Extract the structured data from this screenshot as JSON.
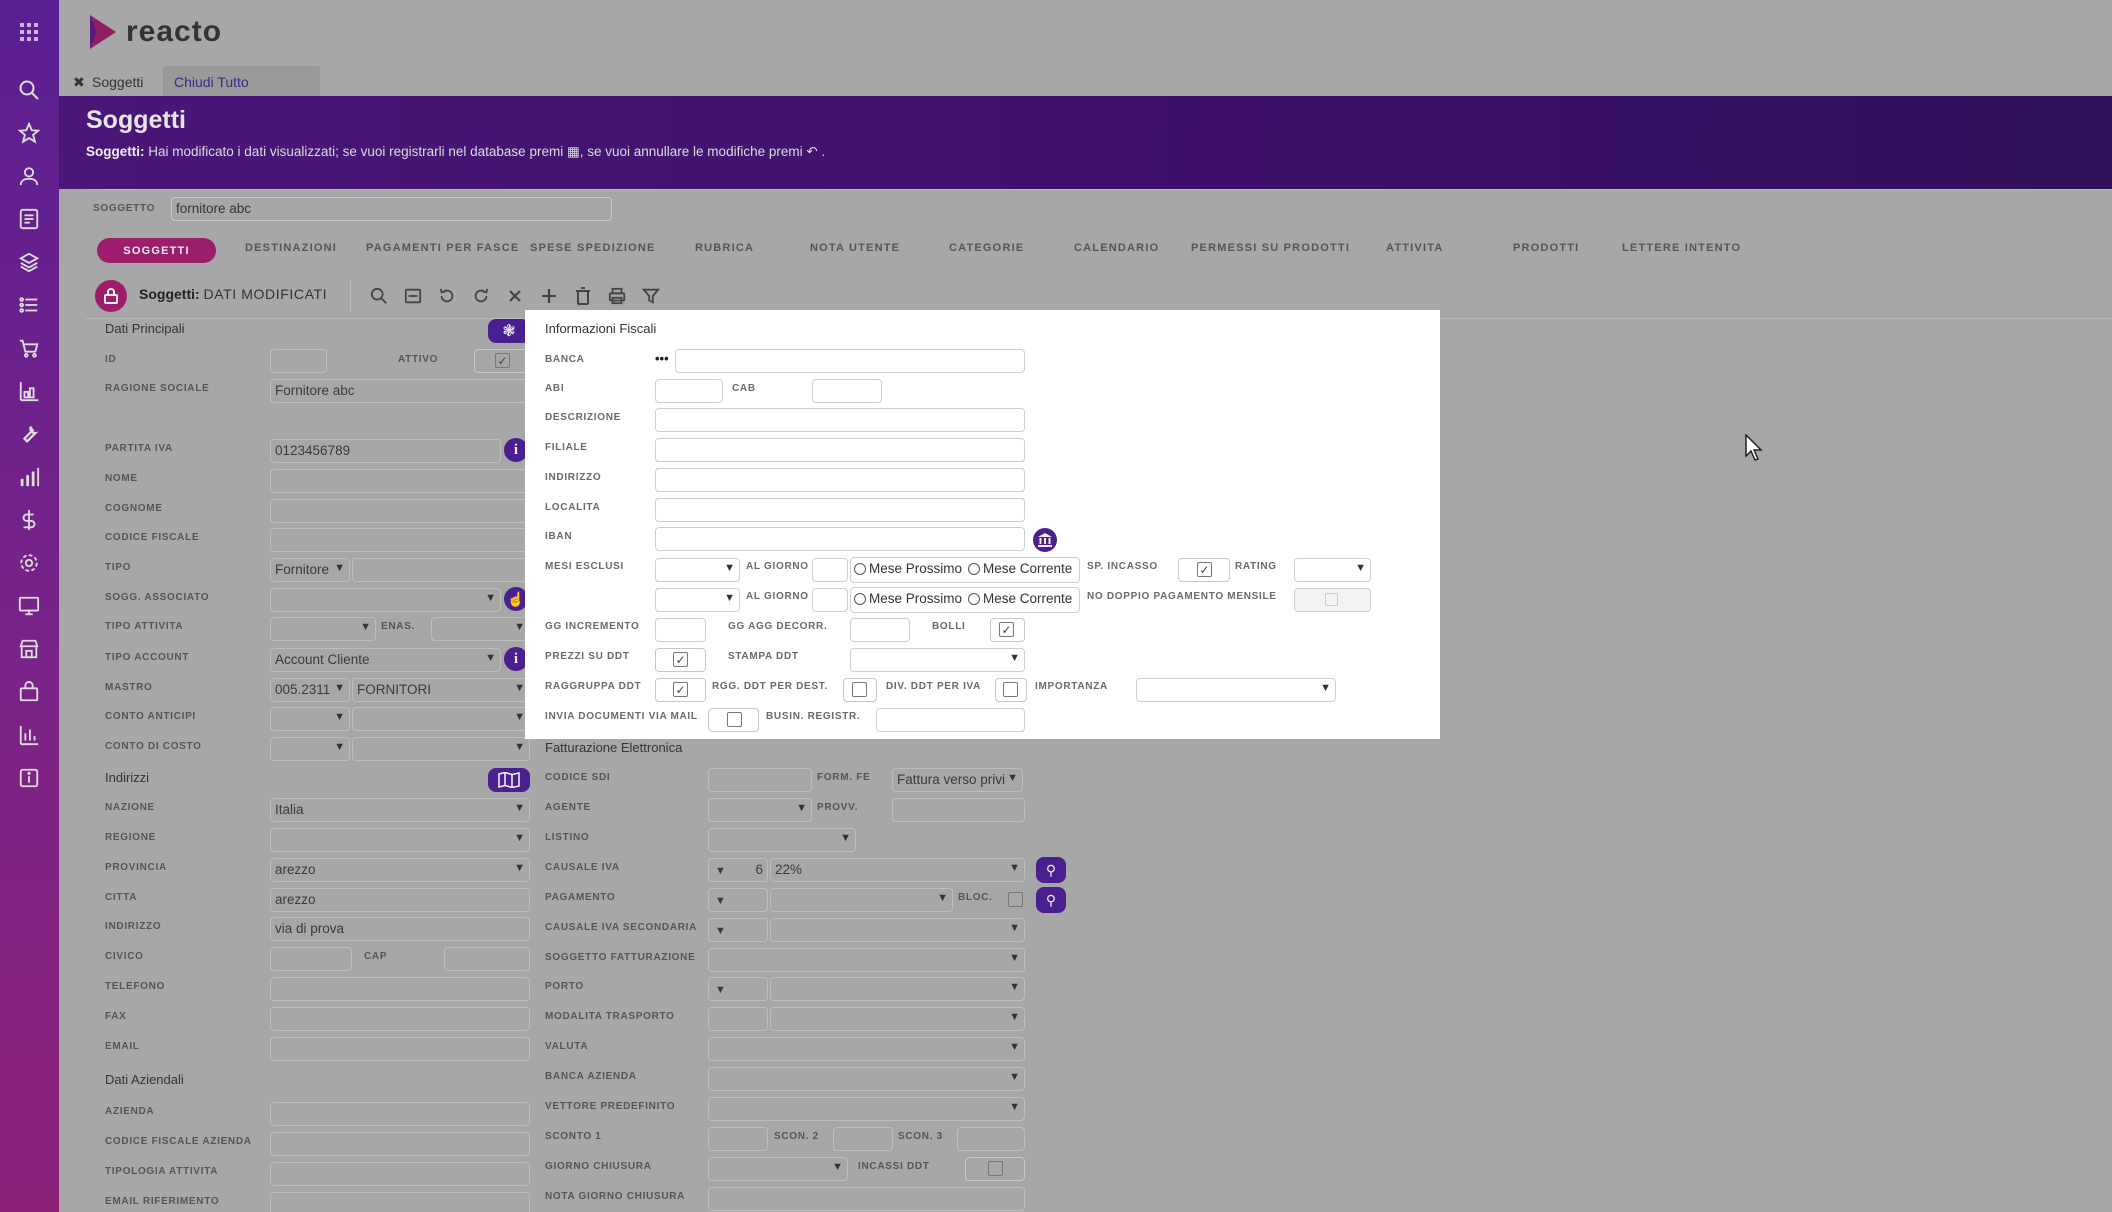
{
  "brand": {
    "name": "reacto"
  },
  "window_tabs": {
    "subjects": "Soggetti",
    "close_all": "Chiudi Tutto"
  },
  "page": {
    "title": "Soggetti",
    "info_prefix": "Soggetti:",
    "info_part1": "Hai modificato i dati visualizzati; se vuoi registrarli nel database premi",
    "info_part2": ", se vuoi annullare le modifiche premi",
    "info_end": "."
  },
  "search": {
    "label": "SOGGETTO",
    "value": "fornitore abc"
  },
  "nav_tabs": [
    "SOGGETTI",
    "DESTINAZIONI",
    "PAGAMENTI PER FASCE",
    "SPESE SPEDIZIONE",
    "RUBRICA",
    "NOTA UTENTE",
    "CATEGORIE",
    "CALENDARIO",
    "PERMESSI SU PRODOTTI",
    "ATTIVITA",
    "PRODOTTI",
    "LETTERE INTENTO"
  ],
  "toolbar": {
    "context": "Soggetti:",
    "status": "DATI MODIFICATI"
  },
  "left": {
    "section_main": "Dati Principali",
    "id": "ID",
    "attivo": "ATTIVO",
    "ragione_sociale": "RAGIONE SOCIALE",
    "ragione_sociale_value": "Fornitore abc",
    "partita_iva": "PARTITA IVA",
    "partita_iva_value": "0123456789",
    "nome": "NOME",
    "cognome": "COGNOME",
    "codice_fiscale": "CODICE FISCALE",
    "tipo": "TIPO",
    "tipo_value": "Fornitore",
    "sogg_associato": "SOGG. ASSOCIATO",
    "tipo_attivita": "TIPO ATTIVITA",
    "enas": "ENAS.",
    "tipo_account": "TIPO ACCOUNT",
    "tipo_account_value": "Account Cliente",
    "mastro": "MASTRO",
    "mastro_code": "005.2311",
    "mastro_desc": "FORNITORI",
    "conto_anticipi": "CONTO ANTICIPI",
    "conto_di_costo": "CONTO DI COSTO",
    "section_addr": "Indirizzi",
    "nazione": "NAZIONE",
    "nazione_value": "Italia",
    "regione": "REGIONE",
    "provincia": "PROVINCIA",
    "provincia_value": "arezzo",
    "citta": "CITTA",
    "citta_value": "arezzo",
    "indirizzo": "INDIRIZZO",
    "indirizzo_value": "via di prova",
    "civico": "CIVICO",
    "cap": "CAP",
    "telefono": "TELEFONO",
    "fax": "FAX",
    "email": "EMAIL",
    "section_company": "Dati Aziendali",
    "azienda": "AZIENDA",
    "cf_azienda": "CODICE FISCALE AZIENDA",
    "tipologia_attivita": "TIPOLOGIA ATTIVITA",
    "email_riferimento": "EMAIL RIFERIMENTO"
  },
  "fiscal": {
    "title": "Informazioni Fiscali",
    "banca": "BANCA",
    "banca_btn": "•••",
    "abi": "ABI",
    "cab": "CAB",
    "descrizione": "DESCRIZIONE",
    "filiale": "FILIALE",
    "indirizzo": "INDIRIZZO",
    "localita": "LOCALITA",
    "iban": "IBAN",
    "mesi_esclusi": "MESI ESCLUSI",
    "al_giorno": "AL GIORNO",
    "mese_prossimo": "Mese Prossimo",
    "mese_corrente": "Mese Corrente",
    "sp_incasso": "SP. INCASSO",
    "rating": "RATING",
    "no_doppio": "NO DOPPIO PAGAMENTO MENSILE",
    "gg_incremento": "GG INCREMENTO",
    "gg_agg": "GG AGG DECORR.",
    "bolli": "BOLLI",
    "prezzi_ddt": "PREZZI SU DDT",
    "stampa_ddt": "STAMPA DDT",
    "raggruppa_ddt": "RAGGRUPPA DDT",
    "rgg_ddt_dest": "RGG. DDT PER DEST.",
    "div_ddt_iva": "DIV. DDT PER IVA",
    "importanza": "IMPORTANZA",
    "invia_mail": "INVIA DOCUMENTI VIA MAIL",
    "busin_registr": "BUSIN. REGISTR."
  },
  "fe": {
    "title": "Fatturazione Elettronica",
    "codice_sdi": "CODICE SDI",
    "form_fe": "FORM. FE",
    "form_fe_value": "Fattura verso privi",
    "agente": "AGENTE",
    "provv": "PROVV.",
    "listino": "LISTINO",
    "causale_iva": "CAUSALE IVA",
    "causale_iva_code": "6",
    "causale_iva_value": "22%",
    "pagamento": "PAGAMENTO",
    "bloc": "BLOC.",
    "causale_iva_sec": "CAUSALE IVA SECONDARIA",
    "sogg_fatt": "SOGGETTO FATTURAZIONE",
    "porto": "PORTO",
    "modalita_trasporto": "MODALITA TRASPORTO",
    "valuta": "VALUTA",
    "banca_azienda": "BANCA AZIENDA",
    "vettore": "VETTORE PREDEFINITO",
    "sconto1": "SCONTO 1",
    "scon2": "SCON. 2",
    "scon3": "SCON. 3",
    "giorno_chiusura": "GIORNO CHIUSURA",
    "incassi_ddt": "INCASSI DDT",
    "nota_giorno": "NOTA GIORNO CHIUSURA"
  }
}
